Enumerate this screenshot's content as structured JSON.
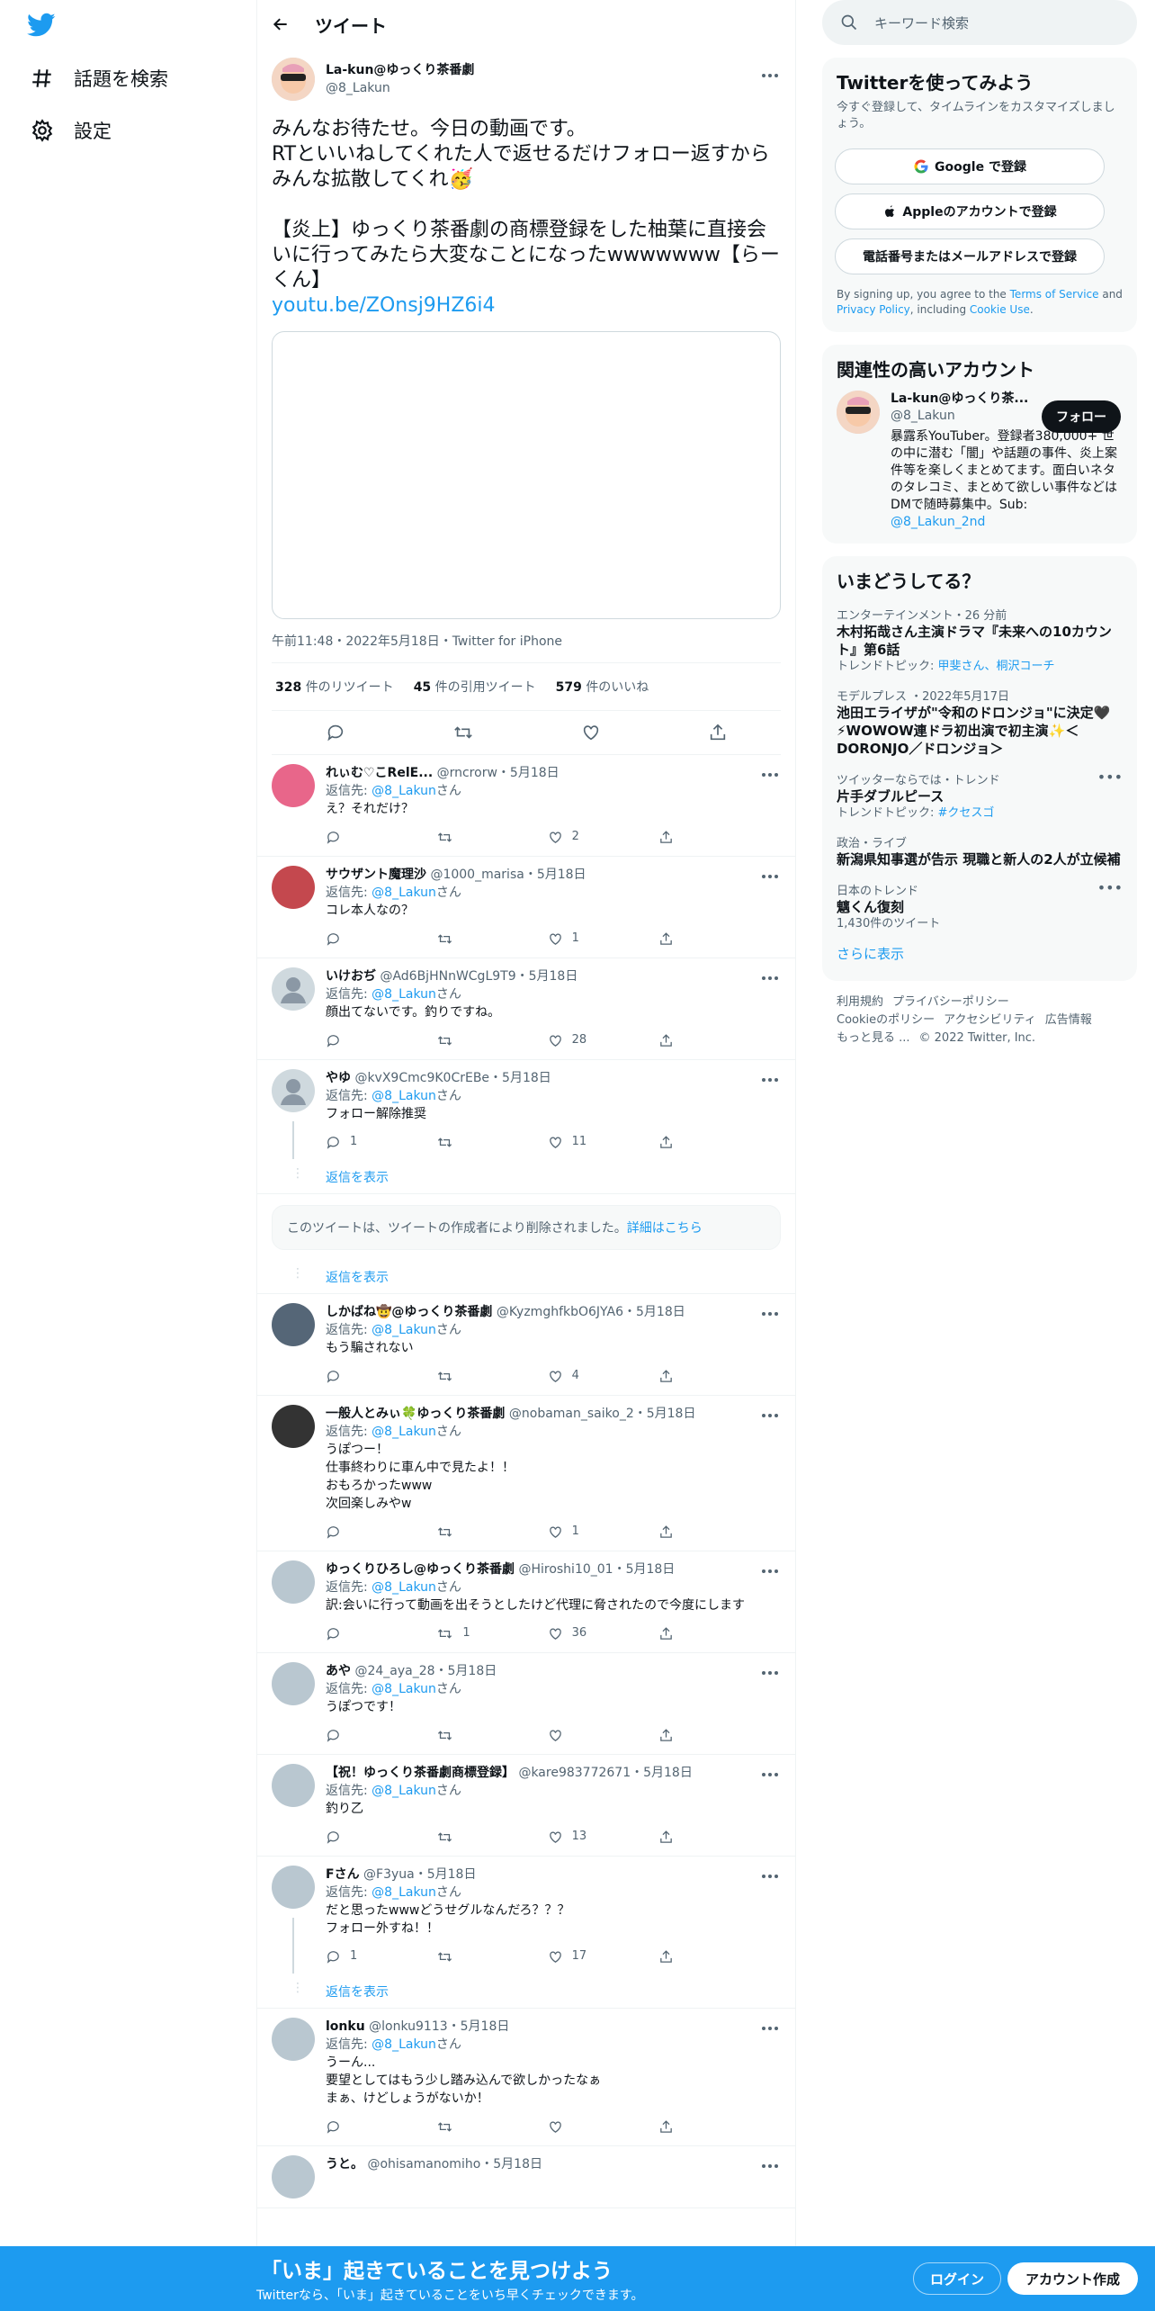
{
  "nav": {
    "explore": "話題を検索",
    "settings": "設定"
  },
  "header": {
    "title": "ツイート"
  },
  "tweet": {
    "display_name": "La-kun@ゆっくり茶番劇",
    "handle": "@8_Lakun",
    "text": "みんなお待たせ。今日の動画です。\nRTといいねしてくれた人で返せるだけフォロー返すからみんな拡散してくれ🥳\n\n【炎上】ゆっくり茶番劇の商標登録をした柚葉に直接会いに行ってみたら大変なことになったwwwwwww【らーくん】",
    "link": "youtu.be/ZOnsj9HZ6i4",
    "meta": "午前11:48・2022年5月18日・Twitter for iPhone",
    "retweets": "328",
    "retweets_label": "件のリツイート",
    "quotes": "45",
    "quotes_label": "件の引用ツイート",
    "likes": "579",
    "likes_label": "件のいいね"
  },
  "reply_to_label": "返信先: ",
  "reply_to_handle": "@8_Lakun",
  "reply_to_suffix": "さん",
  "show_replies": "返信を表示",
  "deleted": {
    "text": "このツイートは、ツイートの作成者により削除されました。",
    "link": "詳細はこちら"
  },
  "replies": [
    {
      "name": "れぃむ♡こRelE...",
      "handle": "@rncrorw・5月18日",
      "text": "え？それだけ？",
      "rt": "",
      "like": "2"
    },
    {
      "name": "サウザント魔理沙",
      "handle": "@1000_marisa・5月18日",
      "text": "コレ本人なの？",
      "rt": "",
      "like": "1"
    },
    {
      "name": "いけおぢ",
      "handle": "@Ad6BjHNnWCgL9T9・5月18日",
      "text": "顔出てないです。釣りですね。",
      "rt": "",
      "like": "28"
    },
    {
      "name": "やゆ",
      "handle": "@kvX9Cmc9K0CrEBe・5月18日",
      "text": "フォロー解除推奨",
      "reply": "1",
      "rt": "",
      "like": "11"
    },
    {
      "name": "しかばね🤠@ゆっくり茶番劇",
      "handle": "@KyzmghfkbO6JYA6・5月18日",
      "text": "もう騙されない",
      "rt": "",
      "like": "4"
    },
    {
      "name": "一般人とみぃ🍀ゆっくり茶番劇",
      "handle": "@nobaman_saiko_2・5月18日",
      "text": "うぽつー！\n仕事終わりに車ん中で見たよ！！\nおもろかったwww\n次回楽しみやw",
      "rt": "",
      "like": "1"
    },
    {
      "name": "ゆっくりひろし@ゆっくり茶番劇",
      "handle": "@Hiroshi10_01・5月18日",
      "text": "訳:会いに行って動画を出そうとしたけど代理に脅されたので今度にします",
      "rt": "1",
      "like": "36"
    },
    {
      "name": "あや",
      "handle": "@24_aya_28・5月18日",
      "text": "うぽつです！",
      "rt": "",
      "like": ""
    },
    {
      "name": "【祝！ゆっくり茶番劇商標登録】",
      "handle": "@kare983772671・5月18日",
      "text": "釣り乙",
      "rt": "",
      "like": "13"
    },
    {
      "name": "Fさん",
      "handle": "@F3yua・5月18日",
      "text": "だと思ったwwwどうせグルなんだろ？？？\nフォロー外すね！！",
      "reply": "1",
      "rt": "",
      "like": "17"
    },
    {
      "name": "lonku",
      "handle": "@lonku9113・5月18日",
      "text": "うーん...\n要望としてはもう少し踏み込んで欲しかったなぁ\nまぁ、けどしょうがないか！",
      "rt": "",
      "like": ""
    },
    {
      "name": "うと。",
      "handle": "@ohisamanomiho・5月18日",
      "text": "",
      "rt": "",
      "like": ""
    }
  ],
  "right": {
    "search_placeholder": "キーワード検索",
    "signup": {
      "title": "Twitterを使ってみよう",
      "sub": "今すぐ登録して、タイムラインをカスタマイズしましょう。",
      "google": "Google で登録",
      "apple": "Appleのアカウントで登録",
      "phone": "電話番号またはメールアドレスで登録",
      "legal_1": "By signing up, you agree to the ",
      "tos": "Terms of Service",
      "legal_2": " and ",
      "privacy": "Privacy Policy",
      "legal_3": ", including ",
      "cookie": "Cookie Use",
      "legal_4": "."
    },
    "related": {
      "title": "関連性の高いアカウント",
      "name": "La-kun@ゆっくり茶...",
      "handle": "@8_Lakun",
      "follow": "フォロー",
      "bio": "暴露系YouTuber。登録者380,000+ 世の中に潜む「闇」や話題の事件、炎上案件等を楽しくまとめてます。面白いネタのタレコミ、まとめて欲しい事件などはDMで随時募集中。Sub: ",
      "bio_link": "@8_Lakun_2nd"
    },
    "trends": {
      "title": "いまどうしてる？",
      "items": [
        {
          "cat": "エンターテインメント・26 分前",
          "name": "木村拓哉さん主演ドラマ『未来への10カウント』第6話",
          "sub_label": "トレンドトピック: ",
          "sub_link": "甲斐さん、桐沢コーチ"
        },
        {
          "cat": "モデルプレス ・2022年5月17日",
          "name": "池田エライザが\"令和のドロンジョ\"に決定🖤⚡WOWOW連ドラ初出演で初主演✨＜DORONJO／ドロンジョ＞",
          "sub_label": "",
          "sub_link": ""
        },
        {
          "cat": "ツイッターならでは・トレンド",
          "name": "片手ダブルピース",
          "sub_label": "トレンドトピック: ",
          "sub_link": "#クセスゴ"
        },
        {
          "cat": "政治・ライブ",
          "name": "新潟県知事選が告示 現職と新人の2人が立候補",
          "sub_label": "",
          "sub_link": ""
        },
        {
          "cat": "日本のトレンド",
          "name": "魑くん復刻",
          "sub_label": "1,430件のツイート",
          "sub_link": ""
        }
      ],
      "show_more": "さらに表示"
    },
    "footer": {
      "l1": "利用規約",
      "l2": "プライバシーポリシー",
      "l3": "Cookieのポリシー",
      "l4": "アクセシビリティ",
      "l5": "広告情報",
      "l6": "もっと見る ...",
      "l7": "© 2022 Twitter, Inc."
    }
  },
  "bottombar": {
    "headline": "「いま」起きていることを見つけよう",
    "sub": "Twitterなら、「いま」起きていることをいち早くチェックできます。",
    "login": "ログイン",
    "signup": "アカウント作成"
  },
  "colors": {
    "accent": "#1d9bf0",
    "text": "#0f1419",
    "muted": "#536471"
  }
}
